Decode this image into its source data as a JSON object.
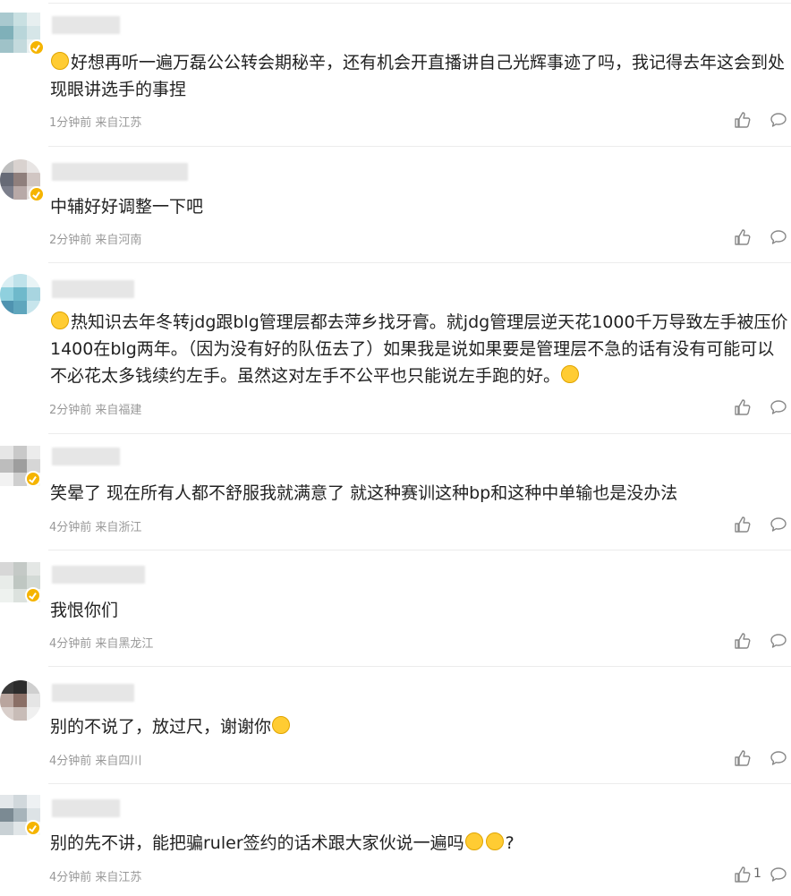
{
  "comments": [
    {
      "text": "好想再听一遍万磊公公转会期秘辛，还有机会开直播讲自己光辉事迹了吗，我记得去年这会到处现眼讲选手的事捏",
      "time": "1分钟前",
      "location": "来自江苏",
      "likes": ""
    },
    {
      "text": "中辅好好调整一下吧",
      "time": "2分钟前",
      "location": "来自河南",
      "likes": ""
    },
    {
      "text": "热知识去年冬转jdg跟blg管理层都去萍乡找牙膏。就jdg管理层逆天花1000千万导致左手被压价1400在blg两年。（因为没有好的队伍去了）如果我是说如果要是管理层不急的话有没有可能可以不必花太多钱续约左手。虽然这对左手不公平也只能说左手跑的好。",
      "time": "2分钟前",
      "location": "来自福建",
      "likes": ""
    },
    {
      "text": "笑晕了 现在所有人都不舒服我就满意了 就这种赛训这种bp和这种中单输也是没办法",
      "time": "4分钟前",
      "location": "来自浙江",
      "likes": ""
    },
    {
      "text": "我恨你们",
      "time": "4分钟前",
      "location": "来自黑龙江",
      "likes": ""
    },
    {
      "text": "别的不说了，放过尺，谢谢你",
      "time": "4分钟前",
      "location": "来自四川",
      "likes": ""
    },
    {
      "text": "别的先不讲，能把骗ruler签约的话术跟大家伙说一遍吗",
      "text_suffix": "?",
      "time": "4分钟前",
      "location": "来自江苏",
      "likes": "1"
    }
  ],
  "icons": {
    "like": "thumbs-up-icon",
    "reply": "comment-bubble-icon",
    "emoji": "emoji-icon"
  },
  "colors": {
    "meta": "#999999",
    "text": "#222222",
    "separator": "#ececec",
    "badge": "#f5b400"
  }
}
